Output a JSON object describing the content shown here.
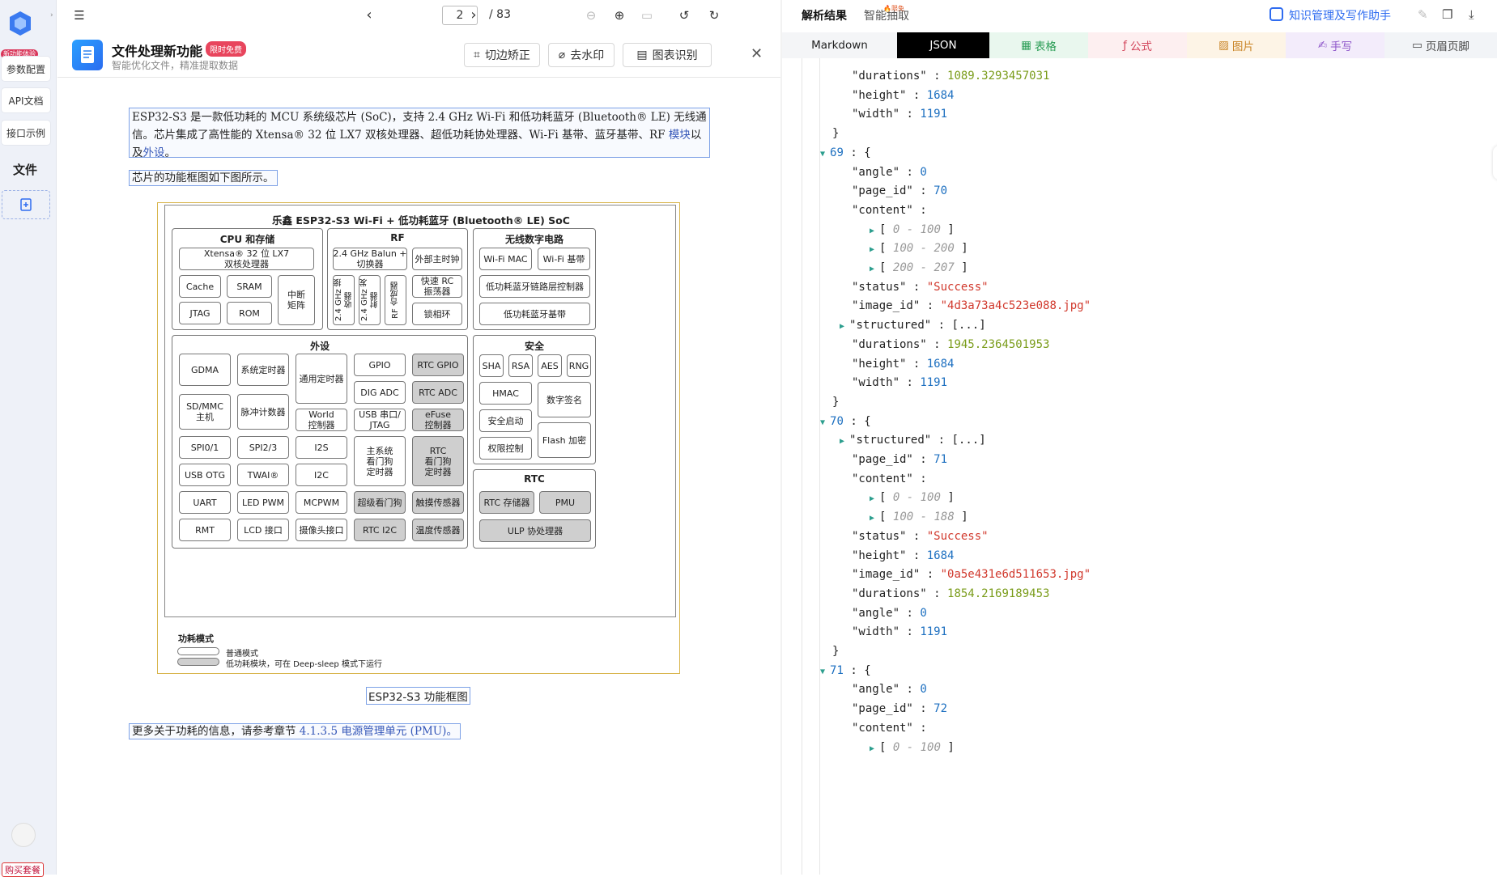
{
  "sidebar": {
    "new_tag": "新功能体验",
    "items": [
      "参数配置",
      "API文档",
      "接口示例"
    ],
    "file_label": "文件",
    "buy_label": "购买套餐"
  },
  "toolbar": {
    "page_current": "2",
    "page_total": "/ 83"
  },
  "banner": {
    "title": "文件处理新功能",
    "tag": "限时免费",
    "subtitle": "智能优化文件，精准提取数据",
    "btn_crop": "切边矫正",
    "btn_watermark": "去水印",
    "btn_chart": "图表识别"
  },
  "document": {
    "para1_a": "ESP32-S3 是一款低功耗的 MCU 系统级芯片 (SoC)，支持 2.4 GHz Wi-Fi 和低功耗蓝牙 (Bluetooth® LE) 无线通",
    "para1_b": "信。芯片集成了高性能的 Xtensa® 32 位 LX7 双核处理器、超低功耗协处理器、Wi-Fi 基带、蓝牙基带、RF ",
    "para1_link1": "模块",
    "para1_c": "以",
    "para1_d": "及",
    "para1_link2": "外设",
    "para1_e": "。",
    "para2": "芯片的功能框图如下图所示。",
    "caption": "ESP32-S3 功能框图",
    "para3_a": "更多关于功耗的信息，请参考章节 ",
    "para3_link": "4.1.3.5 电源管理单元 (PMU)",
    "para3_b": "。"
  },
  "figure": {
    "title": "乐鑫 ESP32-S3 Wi-Fi + 低功耗蓝牙 (Bluetooth® LE) SoC",
    "cpu": {
      "title": "CPU 和存储",
      "xtensa": "Xtensa® 32 位 LX7\n双核处理器",
      "cache": "Cache",
      "sram": "SRAM",
      "int": "中断\n矩阵",
      "jtag": "JTAG",
      "rom": "ROM"
    },
    "rf": {
      "title": "RF",
      "balun": "2.4 GHz Balun +\n切换器",
      "ext": "外部主时钟",
      "rx": "2.4 GHz 接收器",
      "tx": "2.4 GHz 发射器",
      "syn": "RF 合成器",
      "rc": "快速 RC\n振荡器",
      "pll": "锁相环"
    },
    "wireless": {
      "title": "无线数字电路",
      "mac": "Wi-Fi MAC",
      "bb": "Wi-Fi 基带",
      "ble_link": "低功耗蓝牙链路层控制器",
      "ble_bb": "低功耗蓝牙基带"
    },
    "periph": {
      "title": "外设",
      "items": [
        "GDMA",
        "系统定时器",
        "通用定时器",
        "GPIO",
        "RTC GPIO",
        "DIG ADC",
        "RTC ADC",
        "SD/MMC\n主机",
        "脉冲计数器",
        "World\n控制器",
        "USB 串口/\nJTAG",
        "eFuse\n控制器",
        "SPI0/1",
        "SPI2/3",
        "I2S",
        "主系统\n看门狗\n定时器",
        "RTC\n看门狗\n定时器",
        "USB OTG",
        "TWAI®",
        "I2C",
        "UART",
        "LED PWM",
        "MCPWM",
        "超级看门狗",
        "触摸传感器",
        "RMT",
        "LCD 接口",
        "摄像头接口",
        "RTC I2C",
        "温度传感器"
      ]
    },
    "security": {
      "title": "安全",
      "sha": "SHA",
      "rsa": "RSA",
      "aes": "AES",
      "rng": "RNG",
      "hmac": "HMAC",
      "sig": "数字签名",
      "boot": "安全启动",
      "flash": "Flash 加密",
      "perm": "权限控制"
    },
    "rtc": {
      "title": "RTC",
      "mem": "RTC 存储器",
      "pmu": "PMU",
      "ulp": "ULP 协处理器"
    },
    "legend": {
      "title": "功耗模式",
      "normal": "普通模式",
      "low": "低功耗模块，可在 Deep-sleep 模式下运行"
    }
  },
  "right": {
    "tab_result": "解析结果",
    "tab_extract": "智能抽取",
    "hot_tag": "限免",
    "assistant": "知识管理及写作助手",
    "formats": [
      "Markdown",
      "JSON",
      "表格",
      "公式",
      "图片",
      "手写",
      "页眉页脚"
    ]
  },
  "json_view": {
    "lines": [
      {
        "i": 1,
        "key": "\"durations\"",
        "val": "1089.3293457031",
        "t": "flt"
      },
      {
        "i": 1,
        "key": "\"height\"",
        "val": "1684",
        "t": "num"
      },
      {
        "i": 1,
        "key": "\"width\"",
        "val": "1191",
        "t": "num"
      },
      {
        "i": 0,
        "raw": "}"
      },
      {
        "i": 0,
        "key": "69",
        "val": "{",
        "t": "brace",
        "caret": "down"
      },
      {
        "i": 1,
        "key": "\"angle\"",
        "val": "0",
        "t": "num"
      },
      {
        "i": 1,
        "key": "\"page_id\"",
        "val": "70",
        "t": "num"
      },
      {
        "i": 1,
        "key": "\"content\"",
        "val": "",
        "t": "none"
      },
      {
        "i": 2,
        "range": "0 - 100",
        "caret": "right"
      },
      {
        "i": 2,
        "range": "100 - 200",
        "caret": "right"
      },
      {
        "i": 2,
        "range": "200 - 207",
        "caret": "right"
      },
      {
        "i": 1,
        "key": "\"status\"",
        "val": "\"Success\"",
        "t": "str"
      },
      {
        "i": 1,
        "key": "\"image_id\"",
        "val": "\"4d3a73a4c523e088.jpg\"",
        "t": "str"
      },
      {
        "i": 1,
        "key": "\"structured\"",
        "val": "[...]",
        "t": "brace",
        "caret": "right"
      },
      {
        "i": 1,
        "key": "\"durations\"",
        "val": "1945.2364501953",
        "t": "flt"
      },
      {
        "i": 1,
        "key": "\"height\"",
        "val": "1684",
        "t": "num"
      },
      {
        "i": 1,
        "key": "\"width\"",
        "val": "1191",
        "t": "num"
      },
      {
        "i": 0,
        "raw": "}"
      },
      {
        "i": 0,
        "key": "70",
        "val": "{",
        "t": "brace",
        "caret": "down"
      },
      {
        "i": 1,
        "key": "\"structured\"",
        "val": "[...]",
        "t": "brace",
        "caret": "right"
      },
      {
        "i": 1,
        "key": "\"page_id\"",
        "val": "71",
        "t": "num"
      },
      {
        "i": 1,
        "key": "\"content\"",
        "val": "",
        "t": "none"
      },
      {
        "i": 2,
        "range": "0 - 100",
        "caret": "right"
      },
      {
        "i": 2,
        "range": "100 - 188",
        "caret": "right"
      },
      {
        "i": 1,
        "key": "\"status\"",
        "val": "\"Success\"",
        "t": "str"
      },
      {
        "i": 1,
        "key": "\"height\"",
        "val": "1684",
        "t": "num"
      },
      {
        "i": 1,
        "key": "\"image_id\"",
        "val": "\"0a5e431e6d511653.jpg\"",
        "t": "str"
      },
      {
        "i": 1,
        "key": "\"durations\"",
        "val": "1854.2169189453",
        "t": "flt"
      },
      {
        "i": 1,
        "key": "\"angle\"",
        "val": "0",
        "t": "num"
      },
      {
        "i": 1,
        "key": "\"width\"",
        "val": "1191",
        "t": "num"
      },
      {
        "i": 0,
        "raw": "}"
      },
      {
        "i": 0,
        "key": "71",
        "val": "{",
        "t": "brace",
        "caret": "down"
      },
      {
        "i": 1,
        "key": "\"angle\"",
        "val": "0",
        "t": "num"
      },
      {
        "i": 1,
        "key": "\"page_id\"",
        "val": "72",
        "t": "num"
      },
      {
        "i": 1,
        "key": "\"content\"",
        "val": "",
        "t": "none"
      },
      {
        "i": 2,
        "range": "0 - 100",
        "caret": "right"
      }
    ]
  }
}
